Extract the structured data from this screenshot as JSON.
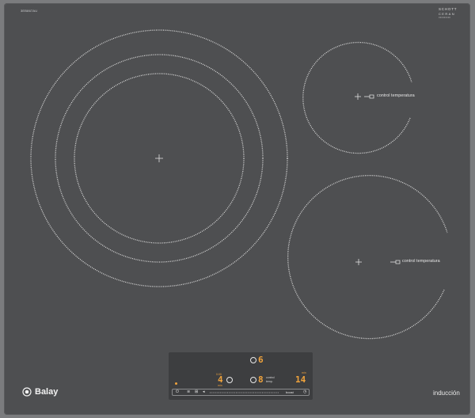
{
  "hob": {
    "model_code": "3EB867AU",
    "glass_brand": {
      "line1": "SCHOTT",
      "line2": "CERAN",
      "line3": "000000000"
    },
    "brand_name": "Balay",
    "type_label": "inducción",
    "zones": [
      {
        "id": "zone-large-left",
        "rings": 3,
        "label": ""
      },
      {
        "id": "zone-small-top-right",
        "rings": 1,
        "label": "control temperatura"
      },
      {
        "id": "zone-medium-bottom-right",
        "rings": 1,
        "label": "control temperatura"
      }
    ]
  },
  "control_panel": {
    "top_display": "6",
    "left_display": "4",
    "middle_display": "8",
    "right_display": "14",
    "left_tiny_top": "0:00",
    "left_tiny_bottom": "min",
    "right_tiny": "min",
    "middle_tiny_a": "control",
    "middle_tiny_b": "temp.",
    "power_symbol": "⏻",
    "boost_symbol": "≋",
    "lock_symbol": "⊞",
    "slider_arrow": "◂",
    "sensor_label": "boost",
    "timer_symbol": "◷",
    "accent_color": "#f0a33c"
  }
}
